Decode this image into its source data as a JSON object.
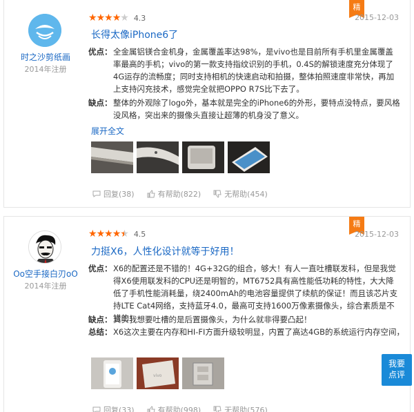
{
  "reviews": [
    {
      "user": {
        "name": "时之沙剪纸画",
        "registered": "2014年注册"
      },
      "rating": {
        "value": "4.3",
        "stars": 4.3
      },
      "badge": "精",
      "date": "2015-12-03",
      "title": "长得太像iPhone6了",
      "pros_label": "优点：",
      "pros": "全金属铝镁合金机身，金属覆盖率达98%，是vivo也是目前所有手机里金属覆盖率最高的手机；vivo的第一款支持指纹识别的手机，0.4S的解锁速度充分体现了4G运存的流畅度；同时支持相机的快速启动和拍摄，整体拍照速度非常快，再加上支持闪充技术，感觉完全就把OPPO R7S比下去了。",
      "cons_label": "缺点：",
      "cons": "整体的外观除了logo外，基本就是完全的iPhone6的外形，要特点没特点，要风格没风格，突出来的摄像头直接让超薄的机身没了意义。",
      "expand": "展开全文",
      "reply": "回复(38)",
      "helpful": "有帮助(822)",
      "unhelpful": "无帮助(454)"
    },
    {
      "user": {
        "name": "Oo空手接白刃oO",
        "registered": "2014年注册"
      },
      "rating": {
        "value": "4.5",
        "stars": 4.5
      },
      "badge": "精",
      "date": "2015-12-03",
      "title": "力挺X6，人性化设计就等于好用！",
      "pros_label": "优点：",
      "pros": "X6的配置还是不错的！4G+32G的组合，够大！有人一直吐槽联发科，但是我觉得X6使用联发科的CPU还是明智的，MT6752具有高性能低功耗的特性，大大降低了手机性能消耗量，绕2400mAh的电池容量提供了续航的保证！而且该芯片支持LTE Cat4网络，支持蓝牙4.0，最高可支持1600万像素摄像头，综合素质是不错的！",
      "cons_label": "缺点：",
      "cons": "其实我想要吐槽的是后置摄像头，为什么就非得要凸起！",
      "summary_label": "总结：",
      "summary": "X6这次主要在内存和HI-FI方面升级较明显，内置了高达4GB的系统运行内存空间，保",
      "reply": "回复(33)",
      "helpful": "有帮助(998)",
      "unhelpful": "无帮助(576)"
    }
  ],
  "fab": {
    "line1": "我要",
    "line2": "点评"
  },
  "colors": {
    "accent": "#1a68c4",
    "star": "#ff6600",
    "badge": "#f57b14",
    "fab": "#1a8ad8"
  }
}
